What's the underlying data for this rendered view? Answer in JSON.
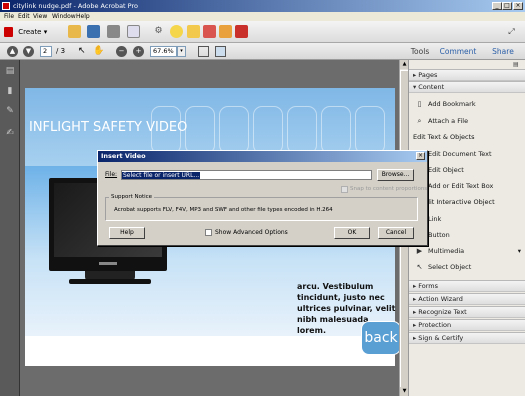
{
  "window": {
    "title": "citylink nudge.pdf - Adobe Acrobat Pro",
    "buttons": {
      "minimize": "_",
      "maximize": "□",
      "close": "×"
    }
  },
  "menu": [
    "File",
    "Edit",
    "View",
    "Window",
    "Help"
  ],
  "toolbar": {
    "create_label": "Create",
    "create_caret": "▾"
  },
  "nav": {
    "page_current": "2",
    "page_total": "/ 3",
    "zoom": "67.6%",
    "zoom_caret": "▾"
  },
  "top_tabs": [
    "Tools",
    "Comment",
    "Share"
  ],
  "document": {
    "heading": "INFLIGHT SAFETY VIDEO",
    "body_text": "arcu. Vestibulum tincidunt, justo nec ultrices pulvinar, velit nibh malesuada lorem.",
    "back_label": "back"
  },
  "right_panel": {
    "pages_label": "Pages",
    "content_label": "Content",
    "content_items": [
      "Add Bookmark",
      "Attach a File"
    ],
    "edit_section": "Edit Text & Objects",
    "edit_items": [
      "Edit Document Text",
      "Edit Object",
      "Add or Edit Text Box"
    ],
    "interactive_section": "or Edit Interactive Object",
    "interactive_items": [
      "Link",
      "Button",
      "Multimedia",
      "Select Object"
    ],
    "multimedia_caret": "▾",
    "bottom_sections": [
      "Forms",
      "Action Wizard",
      "Recognize Text",
      "Protection",
      "Sign & Certify"
    ]
  },
  "dialog": {
    "title": "Insert Video",
    "close_glyph": "×",
    "file_label": "File:",
    "file_value": "Select file or insert URL...",
    "browse_label": "Browse...",
    "snap_label": "Snap to content proportions",
    "group_title": "Support Notice",
    "notice": "Acrobat supports FLV, F4V, MP3 and SWF and other file types encoded in H.264",
    "help_label": "Help",
    "advanced_label": "Show Advanced Options",
    "ok_label": "OK",
    "cancel_label": "Cancel"
  }
}
